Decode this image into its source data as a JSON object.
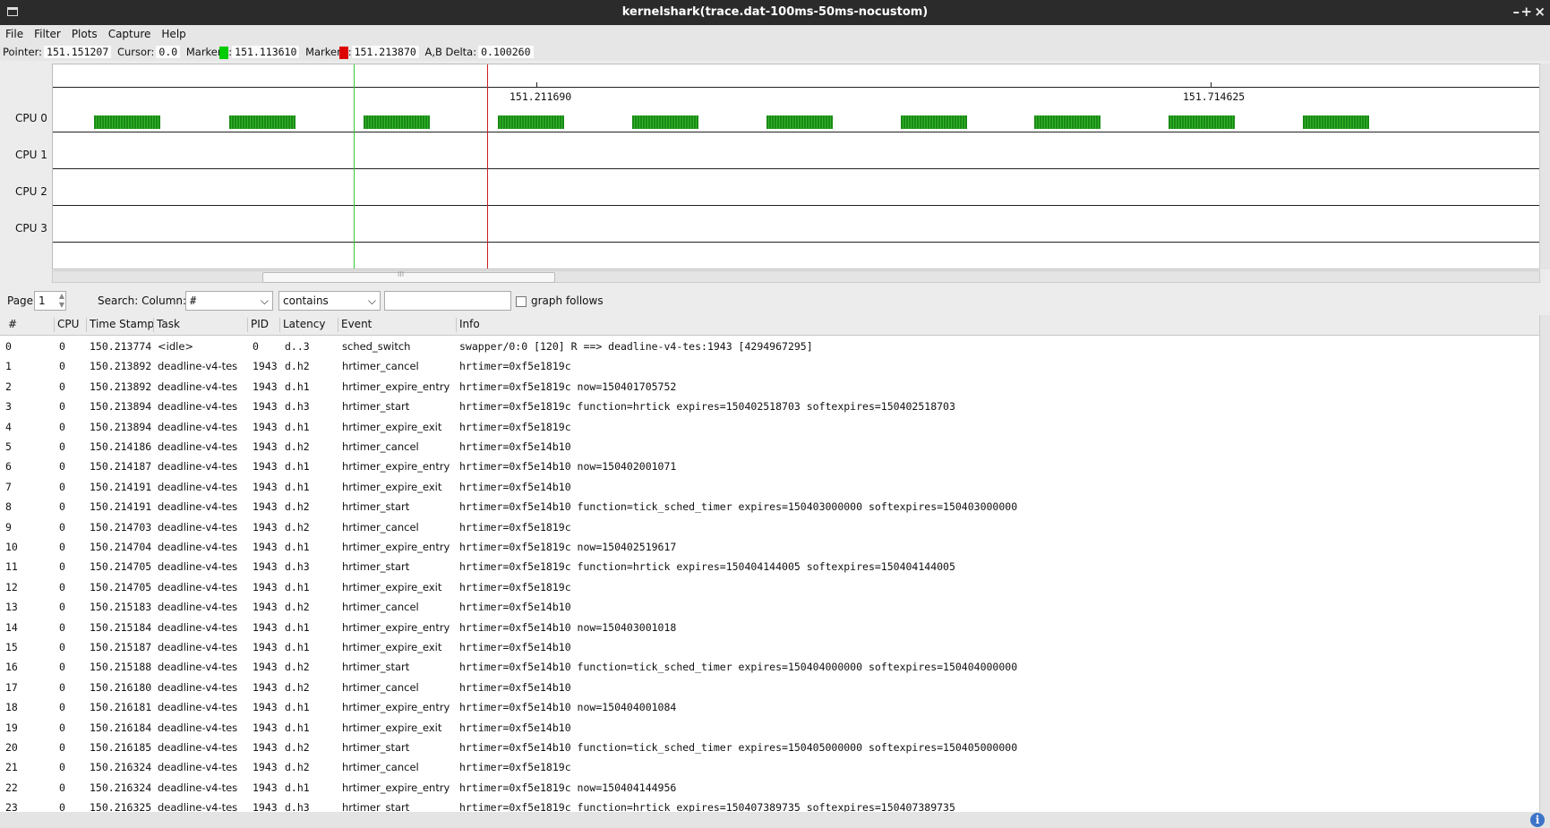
{
  "window": {
    "title": "kernelshark(trace.dat-100ms-50ms-nocustom)",
    "minimize": "–",
    "maximize": "+",
    "close": "×"
  },
  "menu": [
    "File",
    "Filter",
    "Plots",
    "Capture",
    "Help"
  ],
  "pointer_bar": {
    "pointer_label": "Pointer:",
    "pointer_value": "151.151207",
    "cursor_label": "Cursor:",
    "cursor_value": "0.0",
    "marker_a_label": "MarkerA:",
    "marker_a_value": "151.113610",
    "marker_b_label": "MarkerB:",
    "marker_b_value": "151.213870",
    "delta_label": "A,B Delta:",
    "delta_value": "0.100260",
    "marker_a_color": "#00cc00",
    "marker_b_color": "#dd0000"
  },
  "graph": {
    "cpus": [
      "CPU 0",
      "CPU 1",
      "CPU 2",
      "CPU 3"
    ],
    "tick_labels": [
      "151.211690",
      "151.714625"
    ],
    "task_color": "#2aa020",
    "marker_a_line": "#33cc33",
    "marker_b_line": "#cc2222",
    "hscroll_grip": "III"
  },
  "search": {
    "page_label": "Page",
    "page_value": "1",
    "search_label": "Search: Column:",
    "column_value": "#",
    "mode_value": "contains",
    "query_value": "",
    "graph_follows_label": "graph follows"
  },
  "table": {
    "columns": [
      "#",
      "CPU",
      "Time Stamp",
      "Task",
      "PID",
      "Latency",
      "Event",
      "Info"
    ],
    "rows": [
      [
        "0",
        "0",
        "150.213774",
        "<idle>",
        "0",
        "d..3",
        "sched_switch",
        "swapper/0:0 [120] R ==> deadline-v4-tes:1943 [4294967295]"
      ],
      [
        "1",
        "0",
        "150.213892",
        "deadline-v4-tes",
        "1943",
        "d.h2",
        "hrtimer_cancel",
        "hrtimer=0xf5e1819c"
      ],
      [
        "2",
        "0",
        "150.213892",
        "deadline-v4-tes",
        "1943",
        "d.h1",
        "hrtimer_expire_entry",
        "hrtimer=0xf5e1819c now=150401705752"
      ],
      [
        "3",
        "0",
        "150.213894",
        "deadline-v4-tes",
        "1943",
        "d.h3",
        "hrtimer_start",
        "hrtimer=0xf5e1819c function=hrtick expires=150402518703 softexpires=150402518703"
      ],
      [
        "4",
        "0",
        "150.213894",
        "deadline-v4-tes",
        "1943",
        "d.h1",
        "hrtimer_expire_exit",
        "hrtimer=0xf5e1819c"
      ],
      [
        "5",
        "0",
        "150.214186",
        "deadline-v4-tes",
        "1943",
        "d.h2",
        "hrtimer_cancel",
        "hrtimer=0xf5e14b10"
      ],
      [
        "6",
        "0",
        "150.214187",
        "deadline-v4-tes",
        "1943",
        "d.h1",
        "hrtimer_expire_entry",
        "hrtimer=0xf5e14b10 now=150402001071"
      ],
      [
        "7",
        "0",
        "150.214191",
        "deadline-v4-tes",
        "1943",
        "d.h1",
        "hrtimer_expire_exit",
        "hrtimer=0xf5e14b10"
      ],
      [
        "8",
        "0",
        "150.214191",
        "deadline-v4-tes",
        "1943",
        "d.h2",
        "hrtimer_start",
        "hrtimer=0xf5e14b10 function=tick_sched_timer expires=150403000000 softexpires=150403000000"
      ],
      [
        "9",
        "0",
        "150.214703",
        "deadline-v4-tes",
        "1943",
        "d.h2",
        "hrtimer_cancel",
        "hrtimer=0xf5e1819c"
      ],
      [
        "10",
        "0",
        "150.214704",
        "deadline-v4-tes",
        "1943",
        "d.h1",
        "hrtimer_expire_entry",
        "hrtimer=0xf5e1819c now=150402519617"
      ],
      [
        "11",
        "0",
        "150.214705",
        "deadline-v4-tes",
        "1943",
        "d.h3",
        "hrtimer_start",
        "hrtimer=0xf5e1819c function=hrtick expires=150404144005 softexpires=150404144005"
      ],
      [
        "12",
        "0",
        "150.214705",
        "deadline-v4-tes",
        "1943",
        "d.h1",
        "hrtimer_expire_exit",
        "hrtimer=0xf5e1819c"
      ],
      [
        "13",
        "0",
        "150.215183",
        "deadline-v4-tes",
        "1943",
        "d.h2",
        "hrtimer_cancel",
        "hrtimer=0xf5e14b10"
      ],
      [
        "14",
        "0",
        "150.215184",
        "deadline-v4-tes",
        "1943",
        "d.h1",
        "hrtimer_expire_entry",
        "hrtimer=0xf5e14b10 now=150403001018"
      ],
      [
        "15",
        "0",
        "150.215187",
        "deadline-v4-tes",
        "1943",
        "d.h1",
        "hrtimer_expire_exit",
        "hrtimer=0xf5e14b10"
      ],
      [
        "16",
        "0",
        "150.215188",
        "deadline-v4-tes",
        "1943",
        "d.h2",
        "hrtimer_start",
        "hrtimer=0xf5e14b10 function=tick_sched_timer expires=150404000000 softexpires=150404000000"
      ],
      [
        "17",
        "0",
        "150.216180",
        "deadline-v4-tes",
        "1943",
        "d.h2",
        "hrtimer_cancel",
        "hrtimer=0xf5e14b10"
      ],
      [
        "18",
        "0",
        "150.216181",
        "deadline-v4-tes",
        "1943",
        "d.h1",
        "hrtimer_expire_entry",
        "hrtimer=0xf5e14b10 now=150404001084"
      ],
      [
        "19",
        "0",
        "150.216184",
        "deadline-v4-tes",
        "1943",
        "d.h1",
        "hrtimer_expire_exit",
        "hrtimer=0xf5e14b10"
      ],
      [
        "20",
        "0",
        "150.216185",
        "deadline-v4-tes",
        "1943",
        "d.h2",
        "hrtimer_start",
        "hrtimer=0xf5e14b10 function=tick_sched_timer expires=150405000000 softexpires=150405000000"
      ],
      [
        "21",
        "0",
        "150.216324",
        "deadline-v4-tes",
        "1943",
        "d.h2",
        "hrtimer_cancel",
        "hrtimer=0xf5e1819c"
      ],
      [
        "22",
        "0",
        "150.216324",
        "deadline-v4-tes",
        "1943",
        "d.h1",
        "hrtimer_expire_entry",
        "hrtimer=0xf5e1819c now=150404144956"
      ],
      [
        "23",
        "0",
        "150.216325",
        "deadline-v4-tes",
        "1943",
        "d.h3",
        "hrtimer_start",
        "hrtimer=0xf5e1819c function=hrtick expires=150407389735 softexpires=150407389735"
      ]
    ]
  },
  "status": {
    "info_glyph": "i"
  }
}
